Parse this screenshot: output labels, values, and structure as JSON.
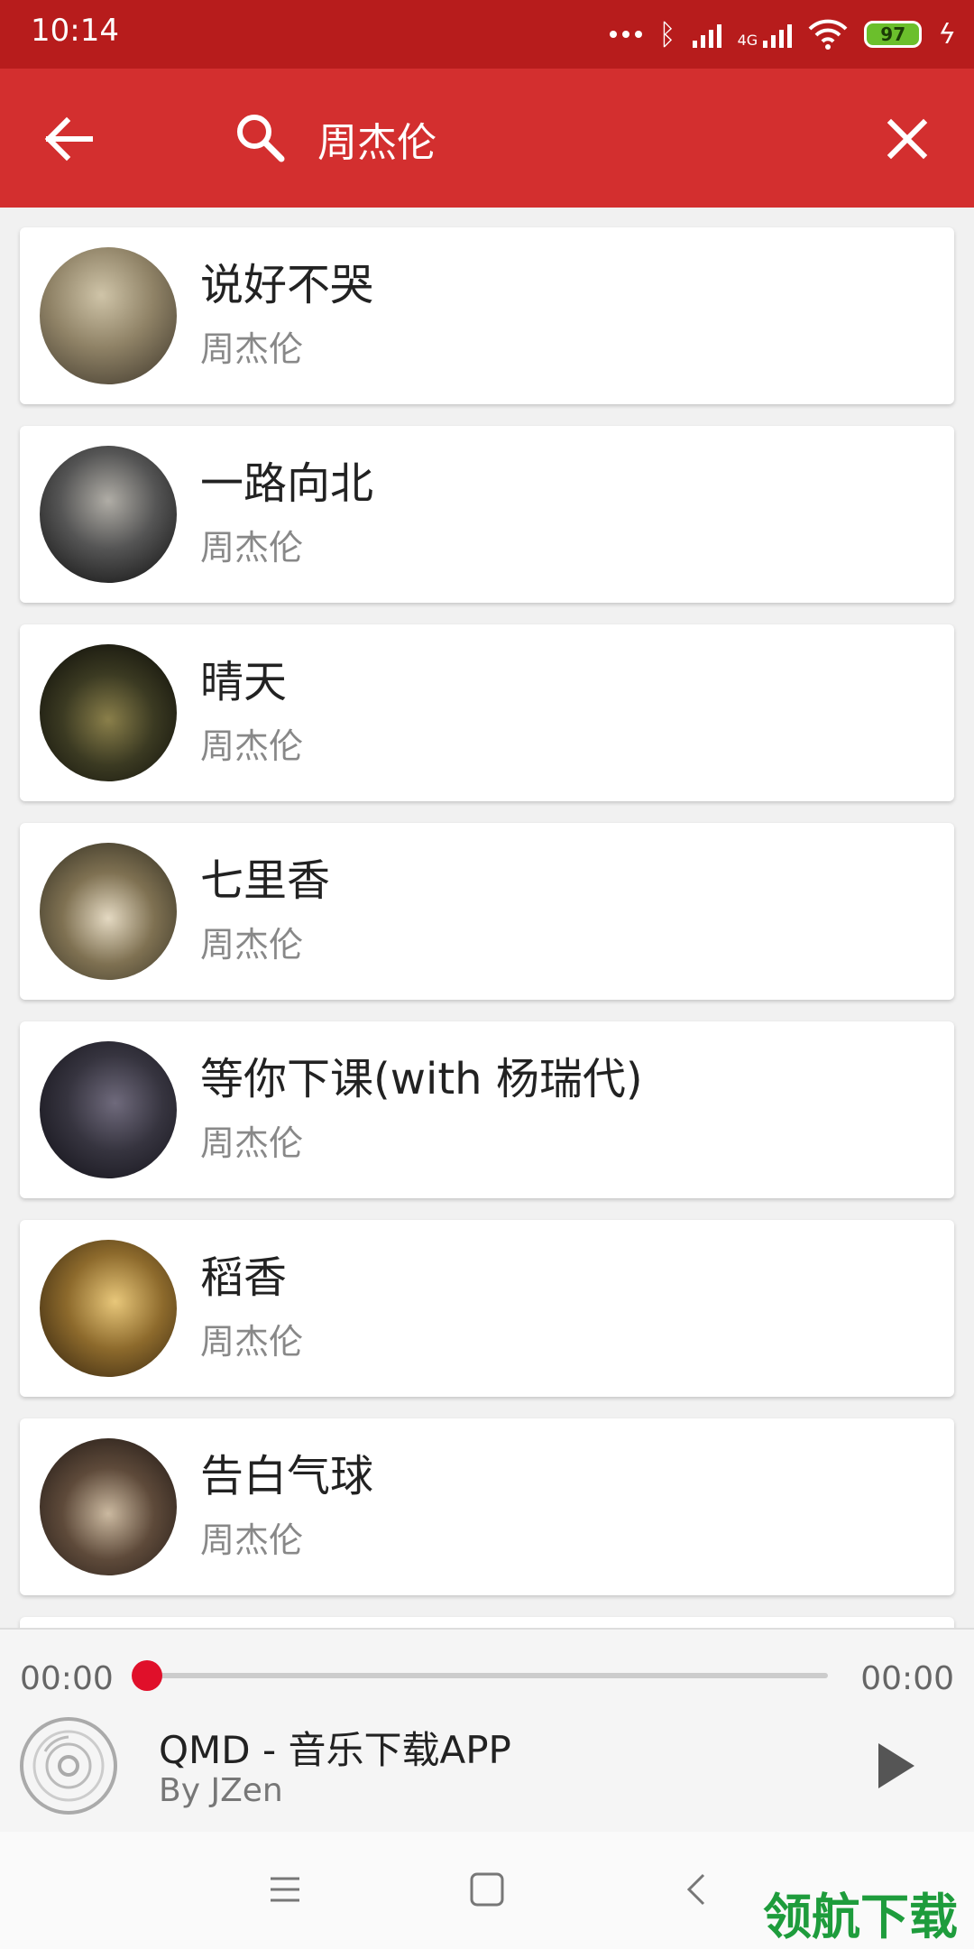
{
  "status_bar": {
    "time": "10:14",
    "network": "4G",
    "battery": "97"
  },
  "search": {
    "query": "周杰伦"
  },
  "songs": [
    {
      "title": "说好不哭",
      "artist": "周杰伦"
    },
    {
      "title": "一路向北",
      "artist": "周杰伦"
    },
    {
      "title": "晴天",
      "artist": "周杰伦"
    },
    {
      "title": "七里香",
      "artist": "周杰伦"
    },
    {
      "title": "等你下课(with 杨瑞代)",
      "artist": "周杰伦"
    },
    {
      "title": "稻香",
      "artist": "周杰伦"
    },
    {
      "title": "告白气球",
      "artist": "周杰伦"
    }
  ],
  "player": {
    "current_time": "00:00",
    "total_time": "00:00",
    "progress": 0,
    "title": "QMD - 音乐下载APP",
    "subtitle": "By JZen"
  },
  "watermark": "领航下载",
  "colors": {
    "primary": "#d32f2f",
    "status_bar": "#b71c1c",
    "accent": "#e0102a"
  }
}
